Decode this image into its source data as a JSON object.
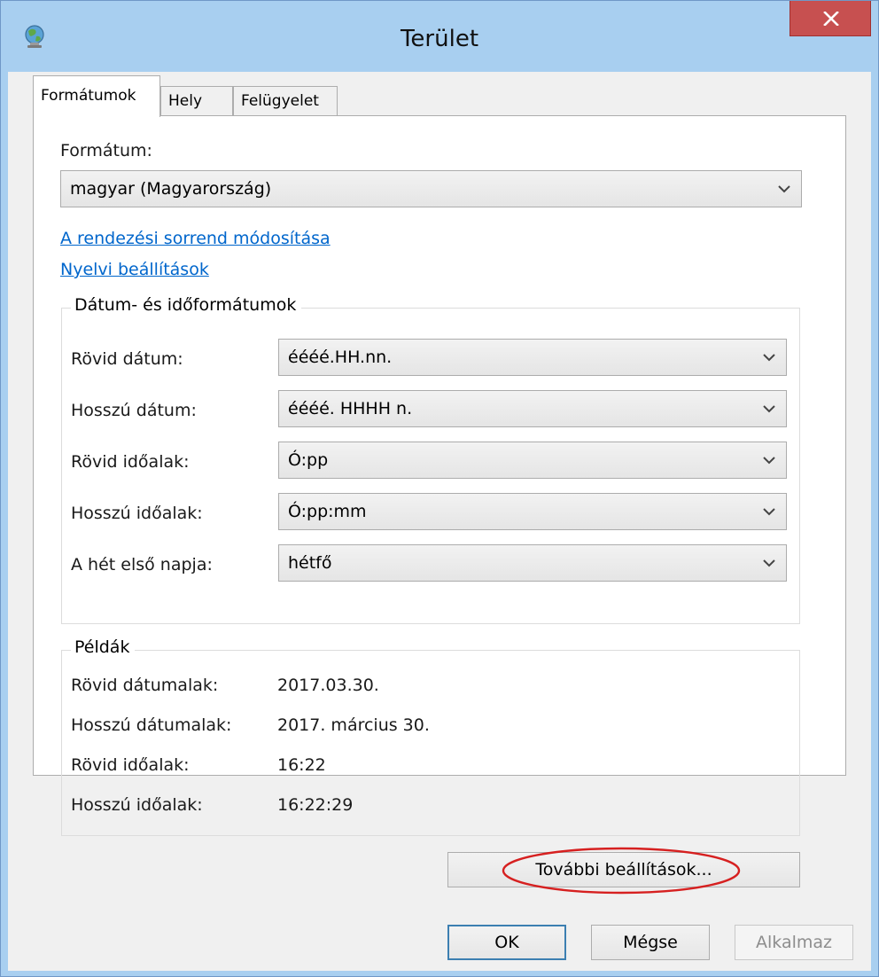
{
  "window": {
    "title": "Terület",
    "close_label": "close"
  },
  "tabs": [
    {
      "label": "Formátumok",
      "active": true
    },
    {
      "label": "Hely",
      "active": false
    },
    {
      "label": "Felügyelet",
      "active": false
    }
  ],
  "format": {
    "label": "Formátum:",
    "selected": "magyar (Magyarország)"
  },
  "links": {
    "sort_order": "A rendezési sorrend módosítása",
    "language_settings": "Nyelvi beállítások"
  },
  "date_time_group": {
    "title": "Dátum- és időformátumok",
    "rows": [
      {
        "label": "Rövid dátum:",
        "value": "éééé.HH.nn."
      },
      {
        "label": "Hosszú dátum:",
        "value": "éééé. HHHH n."
      },
      {
        "label": "Rövid időalak:",
        "value": "Ó:pp"
      },
      {
        "label": "Hosszú időalak:",
        "value": "Ó:pp:mm"
      },
      {
        "label": "A hét első napja:",
        "value": "hétfő"
      }
    ]
  },
  "examples_group": {
    "title": "Példák",
    "rows": [
      {
        "label": "Rövid dátumalak:",
        "value": "2017.03.30."
      },
      {
        "label": "Hosszú dátumalak:",
        "value": "2017. március 30."
      },
      {
        "label": "Rövid időalak:",
        "value": "16:22"
      },
      {
        "label": "Hosszú időalak:",
        "value": "16:22:29"
      }
    ]
  },
  "buttons": {
    "additional_settings": "További beállítások...",
    "ok": "OK",
    "cancel": "Mégse",
    "apply": "Alkalmaz"
  },
  "colors": {
    "title_bar": "#a8cff0",
    "close_button": "#c75050",
    "link": "#0066cc",
    "annotation_ellipse": "#d62020"
  },
  "icons": {
    "app": "globe-icon",
    "close": "close-icon",
    "dropdown": "chevron-down-icon"
  }
}
